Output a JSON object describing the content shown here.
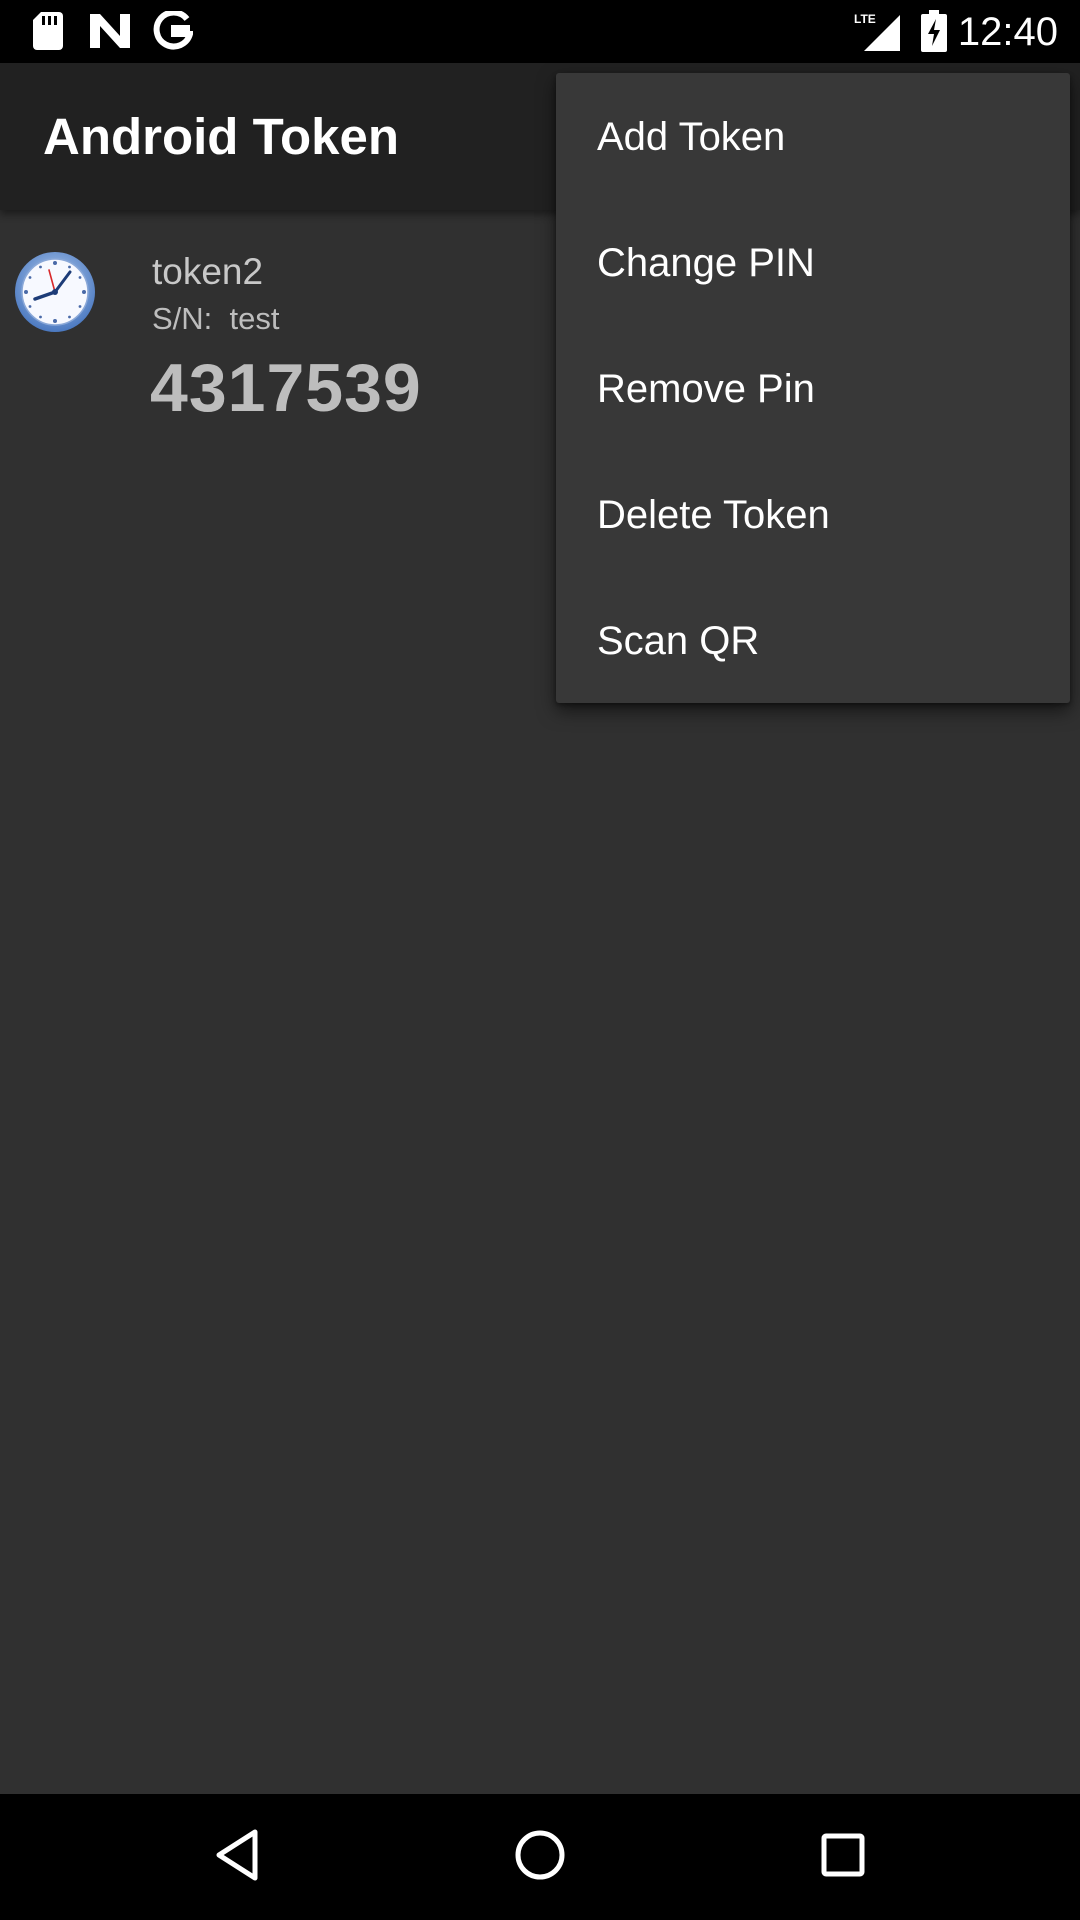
{
  "status_bar": {
    "time": "12:40",
    "network_label": "LTE",
    "icons": [
      "sd-card-icon",
      "n-notification-icon",
      "google-icon",
      "lte-signal-icon",
      "battery-charging-icon"
    ]
  },
  "app": {
    "title": "Android Token"
  },
  "tokens": [
    {
      "name": "token2",
      "serial": "S/N:  test",
      "code": "4317539",
      "icon": "clock-icon"
    }
  ],
  "overflow_menu": {
    "items": [
      {
        "label": "Add Token"
      },
      {
        "label": "Change PIN"
      },
      {
        "label": "Remove Pin"
      },
      {
        "label": "Delete Token"
      },
      {
        "label": "Scan QR"
      }
    ]
  },
  "nav_bar": {
    "buttons": [
      "back-icon",
      "home-icon",
      "recents-icon"
    ]
  },
  "colors": {
    "background": "#303030",
    "action_bar": "#212121",
    "menu_background": "#383838",
    "status_bar": "#000000",
    "code_text": "#bdbdbd"
  }
}
